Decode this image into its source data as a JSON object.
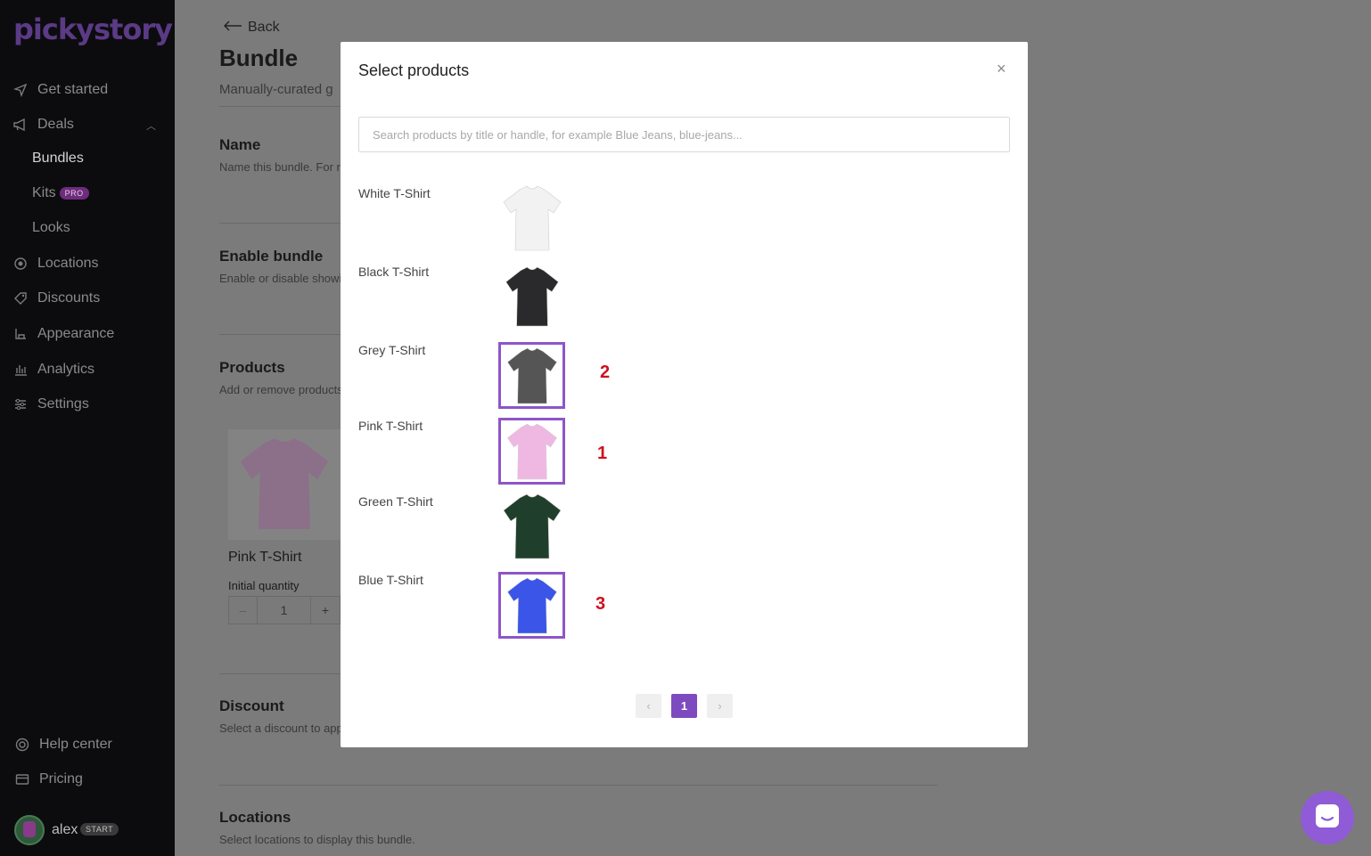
{
  "app": {
    "logo_text": "pickystory",
    "user": {
      "name": "alex",
      "plan_badge": "START"
    }
  },
  "sidebar": {
    "items": [
      {
        "label": "Get started",
        "icon": "send-icon"
      },
      {
        "label": "Deals",
        "icon": "megaphone-icon"
      },
      {
        "label": "Locations",
        "icon": "location-icon"
      },
      {
        "label": "Discounts",
        "icon": "tag-icon"
      },
      {
        "label": "Appearance",
        "icon": "brush-icon"
      },
      {
        "label": "Analytics",
        "icon": "bar-chart-icon"
      },
      {
        "label": "Settings",
        "icon": "sliders-icon"
      }
    ],
    "deals_sub": [
      {
        "label": "Bundles"
      },
      {
        "label": "Kits",
        "badge": "PRO"
      },
      {
        "label": "Looks"
      }
    ],
    "footer": [
      {
        "label": "Help center",
        "icon": "lifebuoy-icon"
      },
      {
        "label": "Pricing",
        "icon": "credit-card-icon"
      }
    ]
  },
  "page": {
    "back_label": "Back",
    "title": "Bundle",
    "subtitle": "Manually-curated g",
    "sections": {
      "name": {
        "title": "Name",
        "desc": "Name this bundle. For re"
      },
      "enable": {
        "title": "Enable bundle",
        "desc": "Enable or disable showin"
      },
      "products": {
        "title": "Products",
        "desc": "Add or remove products"
      },
      "discount": {
        "title": "Discount",
        "desc": "Select a discount to appl"
      },
      "locations": {
        "title": "Locations",
        "desc": "Select locations to display this bundle."
      }
    },
    "product_card": {
      "name": "Pink T-Shirt",
      "qty_label": "Initial quantity",
      "qty_value": "1",
      "minus": "–",
      "plus": "+"
    }
  },
  "modal": {
    "title": "Select products",
    "close": "×",
    "search_placeholder": "Search products by title or handle, for example Blue Jeans, blue-jeans...",
    "products": [
      {
        "name": "White T-Shirt",
        "color": "#f2f2f2",
        "selected": false,
        "selection_order": ""
      },
      {
        "name": "Black T-Shirt",
        "color": "#2a2a2c",
        "selected": false,
        "selection_order": ""
      },
      {
        "name": "Grey T-Shirt",
        "color": "#555555",
        "selected": true,
        "selection_order": "2"
      },
      {
        "name": "Pink T-Shirt",
        "color": "#efb8e3",
        "selected": true,
        "selection_order": "1"
      },
      {
        "name": "Green T-Shirt",
        "color": "#1f3f2c",
        "selected": false,
        "selection_order": ""
      },
      {
        "name": "Blue T-Shirt",
        "color": "#3a55e8",
        "selected": true,
        "selection_order": "3"
      }
    ],
    "pagination": {
      "prev": "‹",
      "current": "1",
      "next": "›"
    }
  },
  "colors": {
    "accent": "#7e4ac0",
    "selection_border": "#8e55c9",
    "annotation_red": "#d0101d"
  }
}
